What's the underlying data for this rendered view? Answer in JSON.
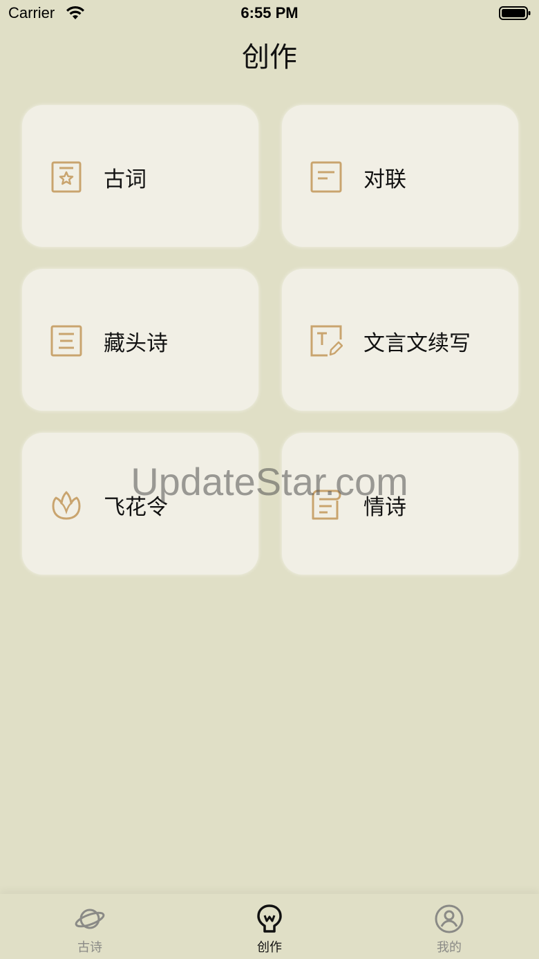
{
  "status_bar": {
    "carrier": "Carrier",
    "time": "6:55 PM"
  },
  "header": {
    "title": "创作"
  },
  "cards": [
    {
      "label": "古词",
      "icon": "star-document-icon"
    },
    {
      "label": "对联",
      "icon": "text-document-icon"
    },
    {
      "label": "藏头诗",
      "icon": "list-document-icon"
    },
    {
      "label": "文言文续写",
      "icon": "edit-text-icon"
    },
    {
      "label": "飞花令",
      "icon": "flower-bud-icon"
    },
    {
      "label": "情诗",
      "icon": "scroll-icon"
    }
  ],
  "watermark": "UpdateStar.com",
  "tab_bar": {
    "items": [
      {
        "label": "古诗",
        "icon": "planet-icon",
        "active": false
      },
      {
        "label": "创作",
        "icon": "lightbulb-icon",
        "active": true
      },
      {
        "label": "我的",
        "icon": "user-icon",
        "active": false
      }
    ]
  },
  "colors": {
    "background": "#e0dfc6",
    "card": "#f1efe5",
    "icon_accent": "#c9a46e",
    "tab_active": "#111111",
    "tab_inactive": "#8a8a86"
  }
}
